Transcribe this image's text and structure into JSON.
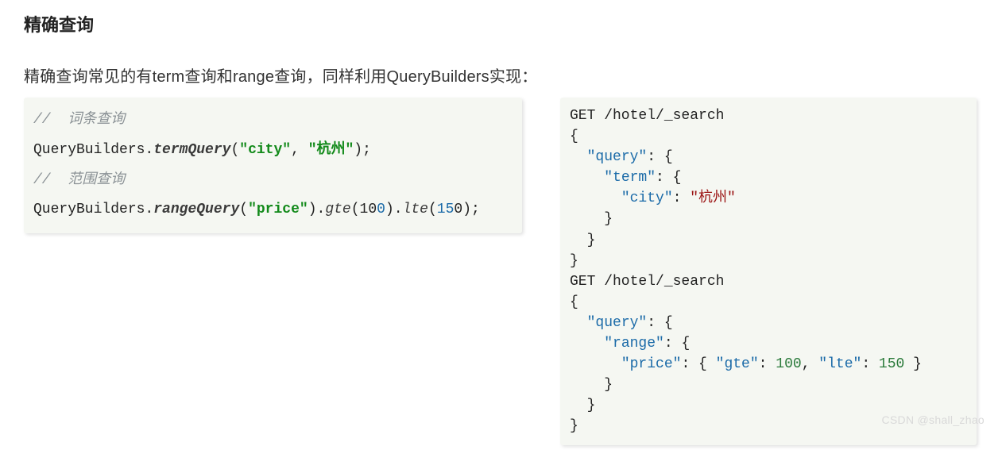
{
  "heading": "精确查询",
  "intro": "精确查询常见的有term查询和range查询，同样利用QueryBuilders实现：",
  "java": {
    "comment_term": "//  词条查询",
    "builder": "QueryBuilders.",
    "term_method": "termQuery",
    "term_arg1": "\"city\"",
    "term_arg2": "\"杭州\"",
    "comment_range": "//  范围查询",
    "range_method": "rangeQuery",
    "range_arg": "\"price\"",
    "gte_name": "gte",
    "gte_val_a": "10",
    "gte_val_b": "0",
    "lte_name": "lte",
    "lte_val_a": "15",
    "lte_val_b": "0"
  },
  "json_req": {
    "get_line": "GET /hotel/_search",
    "lb": "{",
    "rb": "}",
    "lb_sp": ": {",
    "k_query": "\"query\"",
    "k_term": "\"term\"",
    "k_city": "\"city\"",
    "v_city": "\"杭州\"",
    "k_range": "\"range\"",
    "k_price": "\"price\"",
    "k_gte": "\"gte\"",
    "v_gte": "100",
    "k_lte": "\"lte\"",
    "v_lte": "150"
  },
  "watermark": "CSDN @shall_zhao"
}
